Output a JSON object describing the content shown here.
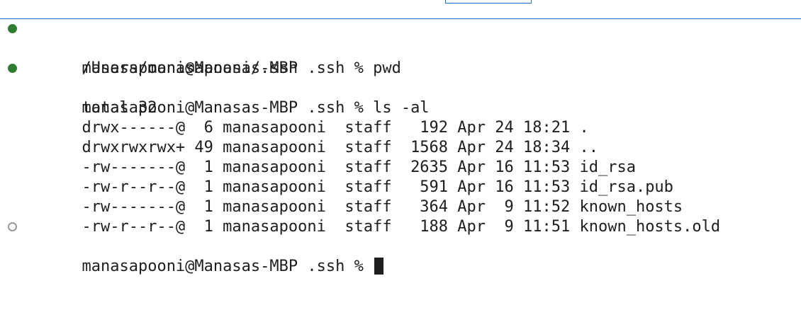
{
  "terminal": {
    "prompt_1": "manasapooni@Manasas-MBP .ssh % pwd",
    "output_pwd": "/Users/manasapooni/.ssh",
    "prompt_2": "manasapooni@Manasas-MBP .ssh % ls -al",
    "ls_total": "total 32",
    "ls_rows": [
      "drwx------@  6 manasapooni  staff   192 Apr 24 18:21 .",
      "drwxrwxrwx+ 49 manasapooni  staff  1568 Apr 24 18:34 ..",
      "-rw-------@  1 manasapooni  staff  2635 Apr 16 11:53 id_rsa",
      "-rw-r--r--@  1 manasapooni  staff   591 Apr 16 11:53 id_rsa.pub",
      "-rw-------@  1 manasapooni  staff   364 Apr  9 11:52 known_hosts",
      "-rw-r--r--@  1 manasapooni  staff   188 Apr  9 11:51 known_hosts.old"
    ],
    "prompt_3": "manasapooni@Manasas-MBP .ssh % "
  },
  "colors": {
    "success_decoration": "#2e7d32",
    "pending_decoration": "#9a9a9a",
    "accent_border": "#1f6fc5"
  }
}
